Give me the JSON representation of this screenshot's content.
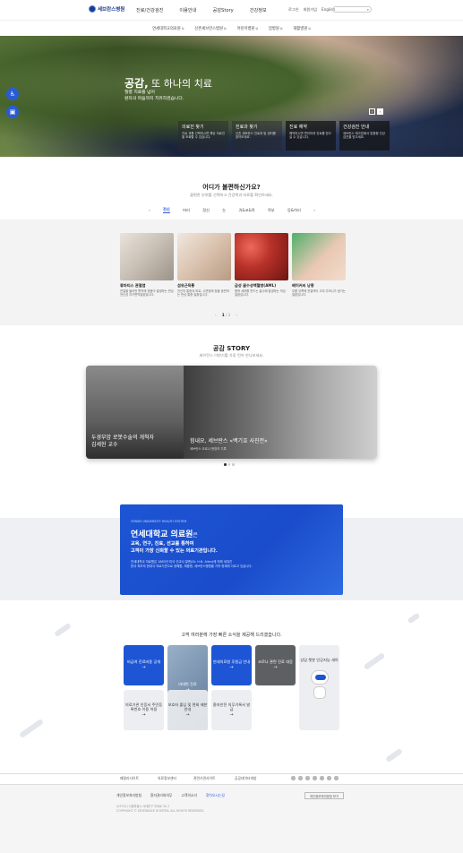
{
  "header": {
    "logo": "세브란스병원",
    "gnb": [
      "진료/건강검진",
      "이용안내",
      "공감Story",
      "건강정보"
    ],
    "utils": [
      "로그인",
      "회원가입",
      "English"
    ],
    "search_icon": "⌕",
    "subnav": [
      "연세대학교의료원",
      "신촌세브란스병원",
      "어린이병원",
      "암병원",
      "재활병원"
    ]
  },
  "hero": {
    "title_bold": "공감,",
    "title_rest": " 또 하나의 치료",
    "sub1": "질병 치료를 넘어",
    "sub2": "환자의 마음까지 치유하겠습니다.",
    "prev": "‹",
    "next": "›",
    "cards": [
      {
        "title": "의료진 찾기",
        "desc": "진료 과를 선택하시면 해당 의료진을 조회할 수 있습니다."
      },
      {
        "title": "진료과 찾기",
        "desc": "신촌 세브란스 진료과 및 센터를 찾아보세요."
      },
      {
        "title": "진료 예약",
        "desc": "예약하시면 편리하게 진료를 받으실 수 있습니다."
      },
      {
        "title": "건강검진 안내",
        "desc": "세브란스 체크업에서 맞춤형 건강검진을 받으세요."
      }
    ],
    "side1": "♿",
    "side2": "▣"
  },
  "symptom": {
    "title": "어디가 불편하신가요?",
    "sub": "불편한 부위를 선택하고 건강백과 자료를 확인하세요.",
    "prev": "‹",
    "next": "›",
    "tabs": [
      "전신",
      "머리",
      "정신",
      "눈",
      "귀&코&목",
      "목부",
      "등&허리"
    ],
    "items": [
      {
        "title": "류마티스 관절염",
        "desc": "관절을 둘러싼 활막에 염증이 발생하는 만성 전신성 자가면역질환입니다."
      },
      {
        "title": "섬유근육통",
        "desc": "전신의 통증과 피로, 수면장애 등을 동반하는 만성 통증 질환입니다."
      },
      {
        "title": "급성 골수성백혈병(AML)",
        "desc": "혈액 세포를 만드는 골수에 발생하는 악성 질환입니다."
      },
      {
        "title": "베이커씨 낭종",
        "desc": "무릎 뒤쪽에 관절액이 고여 주머니가 생기는 질환입니다."
      }
    ],
    "page_prev": "‹",
    "page_current": "1",
    "page_total": "/ 2",
    "page_next": "›"
  },
  "story": {
    "title": "공감 STORY",
    "sub": "세브란스 이야기를 가장 먼저 만나보세요.",
    "left_title_1": "두경부암 로봇수술의 개척자",
    "left_title_2": "김세헌 교수",
    "right_title": "힘내요, 세브란스 «백기호 사진전»",
    "right_sub": "세브란스 코로나 현장의 기록"
  },
  "yonsei": {
    "eyebrow": "YONSEI UNIVERSITY HEALTH SYSTEM",
    "title": "연세대학교 의료원",
    "title_suffix": "은",
    "lead1": "교육, 연구, 진료, 선교를 통하여",
    "lead2": "고객이 가장 신뢰할 수 있는 의료기관입니다.",
    "desc1": "연세대학교 의료원은 1885년 미국 선교사 알렌(Dr. H.N. Allen)에 의해 세워진",
    "desc2": "한국 최초의 현대식 의료기관으로 광혜원, 제중원, 세브란스병원을 거쳐 현재에 이르고 있습니다."
  },
  "quick": {
    "title": "고객 여러분께 가장 빠른 소식을 제공해 드리겠습니다.",
    "items": [
      {
        "label": "비급여 진료비용 공개",
        "arrow": "→"
      },
      {
        "label": "비대면 진료",
        "arrow": "→"
      },
      {
        "label": "연세의료원 후원금 안내",
        "arrow": "→"
      },
      {
        "label": "코로나 관련 진료 대응",
        "arrow": "→"
      },
      {
        "label": "의료기관 인증서 주민등록번호 이용 허용",
        "arrow": "→"
      },
      {
        "label": "보호자 출입 및 면회 제한 안내",
        "arrow": "→"
      },
      {
        "label": "환자안전 의무기록서 발급",
        "arrow": "→"
      }
    ],
    "robot": "상담 챗봇 인공지능 세아"
  },
  "footer": {
    "selects": [
      "패밀리사이트",
      "의료정보센터",
      "관련기관사이트",
      "공공데이터개방"
    ],
    "links": [
      "개인정보처리방침",
      "환자권리와의무",
      "고객의소리",
      "찾아오시는길"
    ],
    "button": "개인정보처리방침 보기",
    "copy1": "(03722) 서울특별시 서대문구 연세로 50-1",
    "copy2": "COPYRIGHT © SEVERANCE HOSPITAL ALL RIGHTS RESERVED."
  }
}
